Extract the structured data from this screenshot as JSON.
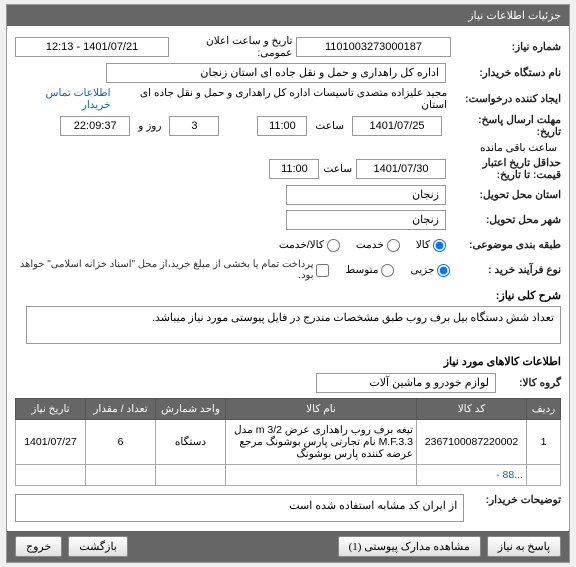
{
  "panel_title": "جزئیات اطلاعات نیاز",
  "fields": {
    "need_no_label": "شماره نیاز:",
    "need_no": "1101003273000187",
    "pub_date_label": "تاریخ و ساعت اعلان عمومی:",
    "pub_date": "1401/07/21 - 12:13",
    "buyer_label": "نام دستگاه خریدار:",
    "buyer": "اداره کل راهداری و حمل و نقل جاده ای استان زنجان",
    "requester_label": "ایجاد کننده درخواست:",
    "requester_name": "مجید علیزاده متصدی تاسیسات اداره کل راهداری و حمل و نقل جاده ای استان",
    "contact_link": "اطلاعات تماس خریدار",
    "deadline_label": "مهلت ارسال پاسخ:",
    "deadline_date_lbl": "تاریخ:",
    "deadline_date": "1401/07/25",
    "deadline_time_lbl": "ساعت",
    "deadline_time": "11:00",
    "days_lbl": "روز و",
    "days_left": "3",
    "hours_left": "22:09:37",
    "hours_lbl": "ساعت باقی مانده",
    "validity_label": "حداقل تاریخ اعتبار",
    "validity_sub": "قیمت: تا تاریخ:",
    "validity_date": "1401/07/30",
    "validity_time_lbl": "ساعت",
    "validity_time": "11:00",
    "province_label": "استان محل تحویل:",
    "province": "زنجان",
    "city_label": "شهر محل تحویل:",
    "city": "زنجان",
    "category_label": "طبقه بندی موضوعی:",
    "cat_goods": "کالا",
    "cat_service": "خدمت",
    "cat_both": "کالا/خدمت",
    "buy_type_label": "نوع فرآیند خرید :",
    "buy_partial": "جزیی",
    "buy_medium": "متوسط",
    "buy_note": "پرداخت تمام یا بخشی از مبلغ خرید،از محل \"اسناد خزانه اسلامی\" خواهد بود.",
    "desc_label": "شرح کلی نیاز:",
    "desc_text": "تعداد شش دستگاه بیل برف روب طبق مشخصات مندرج در فایل پیوستی مورد نیاز میباشد.",
    "items_header": "اطلاعات کالاهای مورد نیاز",
    "group_label": "گروه کالا:",
    "group_value": "لوازم خودرو و ماشین آلات",
    "buyer_note_label": "توضیحات خریدار:",
    "buyer_note_text": "از ایران کد مشابه استفاده شده است"
  },
  "table": {
    "headers": {
      "row": "ردیف",
      "code": "کد کالا",
      "name": "نام کالا",
      "unit": "واحد شمارش",
      "qty": "تعداد / مقدار",
      "date": "تاریخ نیاز"
    },
    "rows": [
      {
        "row": "1",
        "code": "2367100087220002",
        "name": "تیغه برف روب راهداری عرض 3/2 m مدل M.F.3.3 نام تجارتی پارس بوشونگ مرجع عرضه کننده پارس بوشونگ",
        "unit": "دستگاه",
        "qty": "6",
        "date": "1401/07/27"
      }
    ]
  },
  "buttons": {
    "reply": "پاسخ به نیاز",
    "attachments": "مشاهده مدارک پیوستی (1)",
    "back": "بازگشت",
    "exit": "خروج"
  }
}
